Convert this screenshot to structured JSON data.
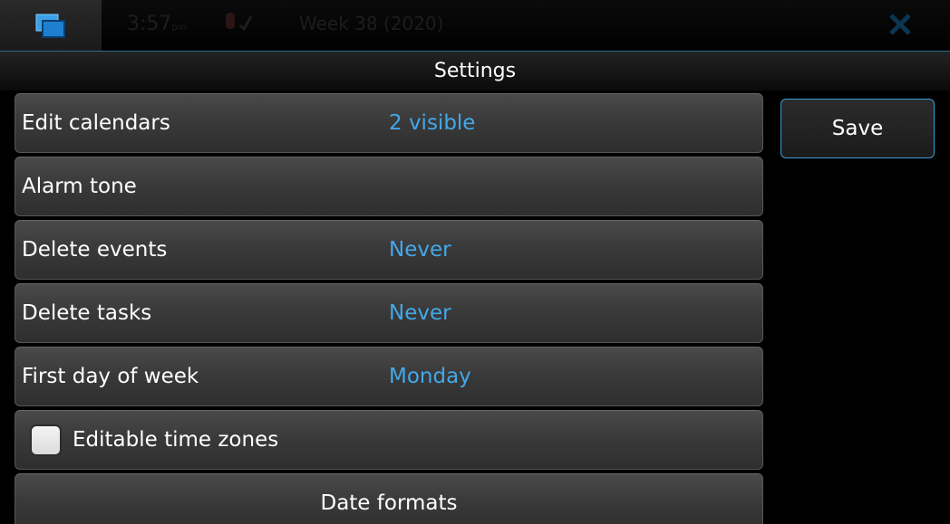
{
  "status_bar": {
    "time": "3:57",
    "time_suffix": "pm",
    "week": "Week 38 (2020)",
    "icons": [
      "task-switcher-icon",
      "alarm-icon",
      "close-icon"
    ]
  },
  "header": {
    "title": "Settings"
  },
  "settings": {
    "edit_calendars": {
      "label": "Edit calendars",
      "value": "2 visible"
    },
    "alarm_tone": {
      "label": "Alarm tone",
      "value": ""
    },
    "delete_events": {
      "label": "Delete events",
      "value": "Never"
    },
    "delete_tasks": {
      "label": "Delete tasks",
      "value": "Never"
    },
    "first_day_of_week": {
      "label": "First day of week",
      "value": "Monday"
    },
    "editable_time_zones": {
      "label": "Editable time zones",
      "checked": false
    },
    "date_formats": {
      "label": "Date formats"
    }
  },
  "actions": {
    "save_label": "Save"
  },
  "colors": {
    "accent": "#43a8ea",
    "button_border": "#3d9bd4",
    "background": "#000000"
  }
}
